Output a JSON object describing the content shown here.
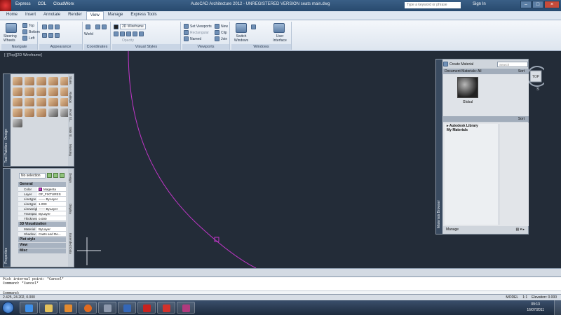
{
  "titlebar": {
    "menus": [
      "Express",
      "COL",
      "CloudWorx"
    ],
    "title": "AutoCAD Architecture 2012 - UNREGISTERED VERSION    seats main.dwg",
    "search_placeholder": "Type a keyword or phrase",
    "sign_in": "Sign In"
  },
  "ribbon_tabs": [
    "Home",
    "Insert",
    "Annotate",
    "Render",
    "View",
    "Manage",
    "Express Tools"
  ],
  "active_tab": "View",
  "ribbon": {
    "navigate": {
      "title": "Navigate",
      "steering": "Steering Wheels",
      "views": [
        "Top",
        "Bottom",
        "Left"
      ]
    },
    "appearance_title": "Appearance",
    "coordinates": {
      "title": "Coordinates",
      "world": "World"
    },
    "visual_styles": {
      "title": "Visual Styles",
      "style_value": "2D Wireframe",
      "lower_value": "Opacity"
    },
    "viewports": {
      "title": "Viewports",
      "set_viewports": "Set Viewports",
      "rectangular": "Rectangular",
      "named": "Named",
      "new": "New",
      "clip": "Clip",
      "join": "Join"
    },
    "windows": {
      "title": "Windows",
      "switch": "Switch Windows",
      "user_interface": "User Interface"
    }
  },
  "viewport_label": "[-][Top][2D Wireframe]",
  "tool_palette": {
    "title": "Tool Palettes - Design",
    "tabs": [
      "Stairs",
      "Railings",
      "Roof Sl...",
      "Slab Sl...",
      "Massing"
    ]
  },
  "properties": {
    "title": "Properties",
    "selection": "No selection",
    "sections": {
      "general": "General",
      "viz": "3D Visualization",
      "plot": "Plot style",
      "view": "View",
      "misc": "Misc"
    },
    "general_rows": [
      {
        "key": "Color",
        "value": "Magenta"
      },
      {
        "key": "Layer",
        "value": "GF_FIXTURES"
      },
      {
        "key": "Linetype",
        "value": "—— ByLayer"
      },
      {
        "key": "Linetype ...",
        "value": "1.000"
      },
      {
        "key": "Lineweight",
        "value": "—— ByLayer"
      },
      {
        "key": "Transpar...",
        "value": "ByLayer"
      },
      {
        "key": "Thickness",
        "value": "0.000"
      }
    ],
    "viz_rows": [
      {
        "key": "Material",
        "value": "ByLayer"
      },
      {
        "key": "Shadow ...",
        "value": "Casts and Re..."
      }
    ],
    "tabs": [
      "Design",
      "Display",
      "Extended Data"
    ]
  },
  "materials": {
    "title": "Materials Browser",
    "create": "Create Material",
    "search_placeholder": "Search",
    "doc_header": "Document Materials: All",
    "sort": "Sort",
    "material_name": "Global",
    "library_root": "Autodesk Library",
    "library_child": "My Materials",
    "manage": "Manage"
  },
  "viewcube": {
    "face": "TOP"
  },
  "command_history": [
    "Pick internal point: *Cancel*",
    "Command: *Cancel*"
  ],
  "command_prompt": "Command:",
  "status": {
    "coords": "2.425, 24.202, 0.000",
    "model": "MODEL",
    "scale": "1:1",
    "elevation": "Elevation: 0.000"
  },
  "taskbar": {
    "time": "09:13",
    "date": "16/07/2011"
  },
  "colors": {
    "canvas": "#232c38",
    "curve": "#c236c9",
    "accent": "#3a5f86"
  }
}
